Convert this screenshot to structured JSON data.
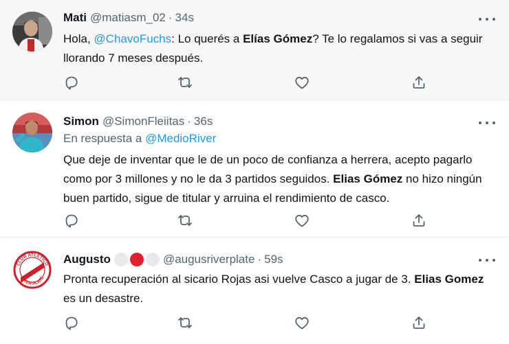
{
  "tweets": [
    {
      "display_name": "Mati",
      "handle": "@matiasm_02",
      "separator": "·",
      "time": "34s",
      "text_parts": {
        "t0": "Hola, ",
        "m0": "@ChavoFuchs",
        "t1": ": Lo querés a ",
        "b0": "Elías Gómez",
        "t2": "? Te lo regalamos si vas a seguir llorando 7 meses después."
      },
      "avatar_icon": "person-photo-icon"
    },
    {
      "display_name": "Simon",
      "handle": "@SimonFleiitas",
      "separator": "·",
      "time": "36s",
      "reply_prefix": "En respuesta a ",
      "reply_to": "@MedioRiver",
      "text_parts": {
        "t0": "Que deje de inventar que le de un poco de confianza a herrera, acepto pagarlo como por 3 millones y no le da 3 partidos seguidos. ",
        "b0": "Elias Gómez",
        "t1": " no hizo ningún buen partido, sigue de titular y arruina el rendimiento de casco."
      },
      "avatar_icon": "player-photo-icon"
    },
    {
      "display_name": "Augusto",
      "emoji_colors": [
        "#e9e9e9",
        "#e0202e",
        "#e9e9e9"
      ],
      "handle": "@augusriverplate",
      "separator": "·",
      "time": "59s",
      "text_parts": {
        "t0": "Pronta recuperación al sicario Rojas asi vuelve Casco a jugar de 3. ",
        "b0": "Elias Gomez",
        "t1": " es un desastre."
      },
      "avatar_icon": "river-plate-crest-icon",
      "crest_text": {
        "top": "CLUB ATLÉTICO",
        "bottom": "RIVER PLATE"
      }
    }
  ],
  "colors": {
    "text": "#0f1419",
    "secondary": "#536471",
    "link": "#1d9bf0",
    "highlight_bg": "#f7f7f7",
    "river_red": "#e0202e"
  },
  "action_icons": [
    "reply-icon",
    "retweet-icon",
    "like-icon",
    "share-icon"
  ]
}
